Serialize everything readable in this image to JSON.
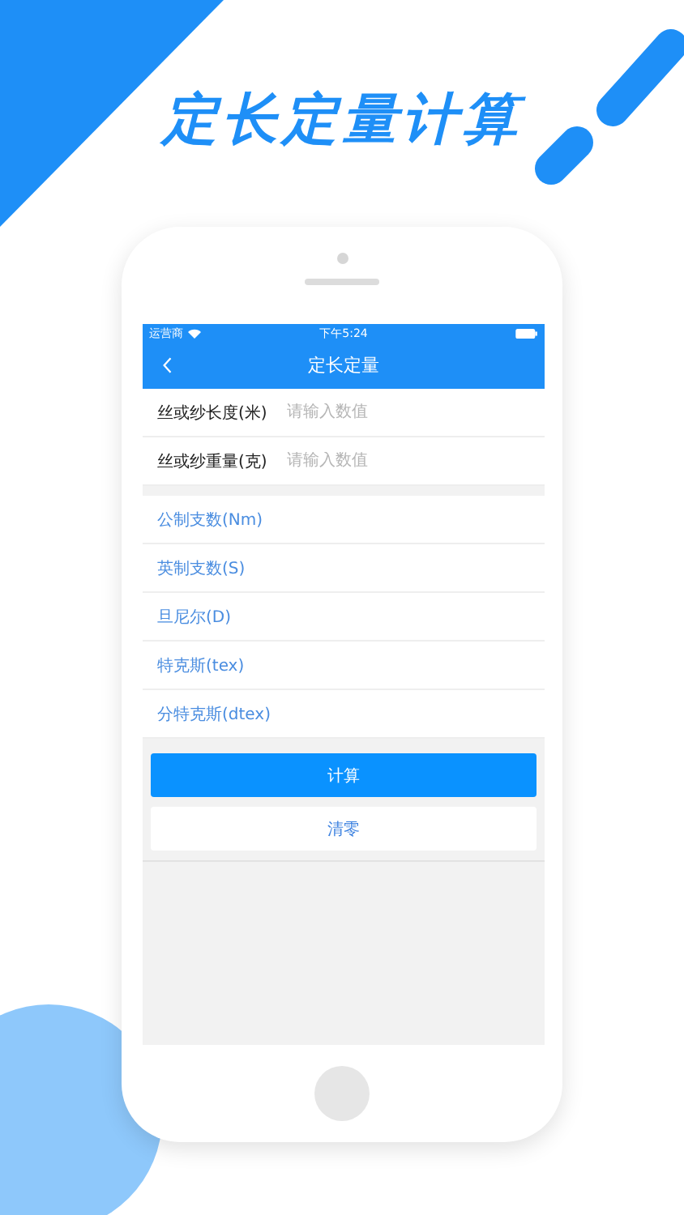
{
  "headline": "定长定量计算",
  "status_bar": {
    "carrier": "运营商",
    "time": "下午5:24"
  },
  "nav": {
    "title": "定长定量"
  },
  "inputs": [
    {
      "label": "丝或纱长度(米)",
      "placeholder": "请输入数值"
    },
    {
      "label": "丝或纱重量(克)",
      "placeholder": "请输入数值"
    }
  ],
  "results": [
    "公制支数(Nm)",
    "英制支数(S)",
    "旦尼尔(D)",
    "特克斯(tex)",
    "分特克斯(dtex)"
  ],
  "buttons": [
    {
      "label": "计算",
      "kind": "primary"
    },
    {
      "label": "清零",
      "kind": "secondary"
    }
  ]
}
